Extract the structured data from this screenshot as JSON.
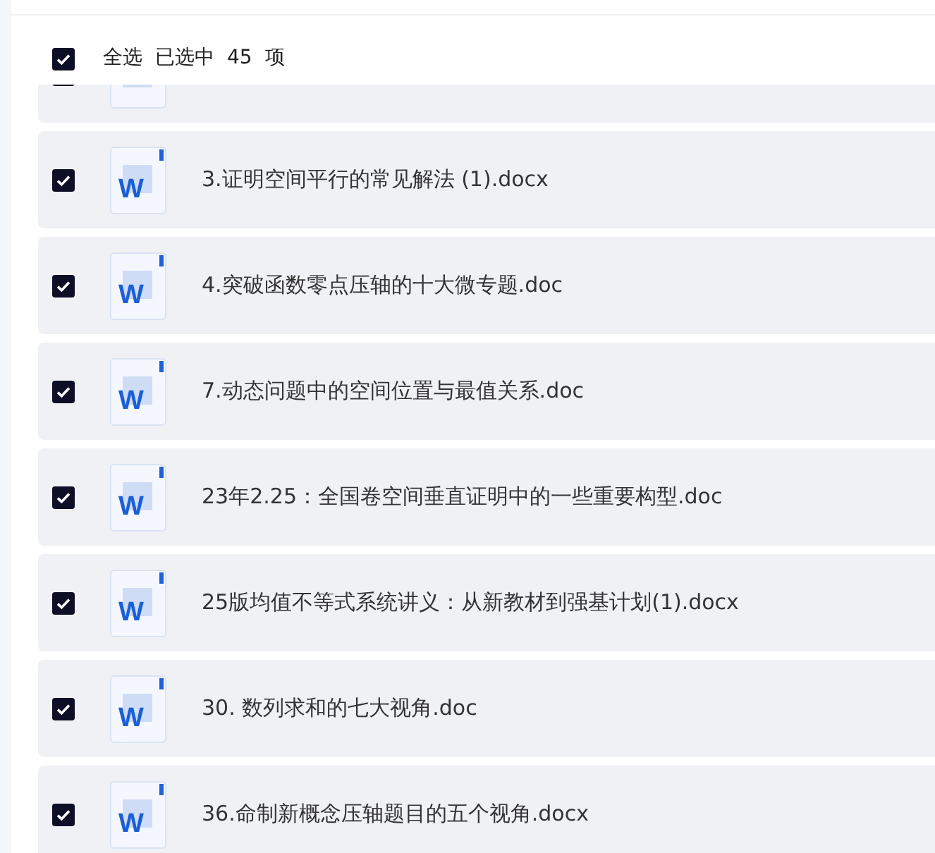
{
  "header": {
    "select_all": {
      "label": "全选",
      "checked": true
    },
    "selected_text": "已选中",
    "count": "45",
    "unit": "项"
  },
  "files": [
    {
      "checked": true,
      "partial": true
    },
    {
      "checked": true,
      "icon": "W",
      "name": "3.证明空间平行的常见解法 (1).docx"
    },
    {
      "checked": true,
      "icon": "W",
      "name": "4.突破函数零点压轴的十大微专题.doc"
    },
    {
      "checked": true,
      "icon": "W",
      "name": "7.动态问题中的空间位置与最值关系.doc"
    },
    {
      "checked": true,
      "icon": "W",
      "name": "23年2.25：全国卷空间垂直证明中的一些重要构型.doc"
    },
    {
      "checked": true,
      "icon": "W",
      "name": "25版均值不等式系统讲义：从新教材到强基计划(1).docx"
    },
    {
      "checked": true,
      "icon": "W",
      "name": "30. 数列求和的七大视角.doc"
    },
    {
      "checked": true,
      "icon": "W",
      "name": "36.命制新概念压轴题目的五个视角.docx"
    }
  ]
}
